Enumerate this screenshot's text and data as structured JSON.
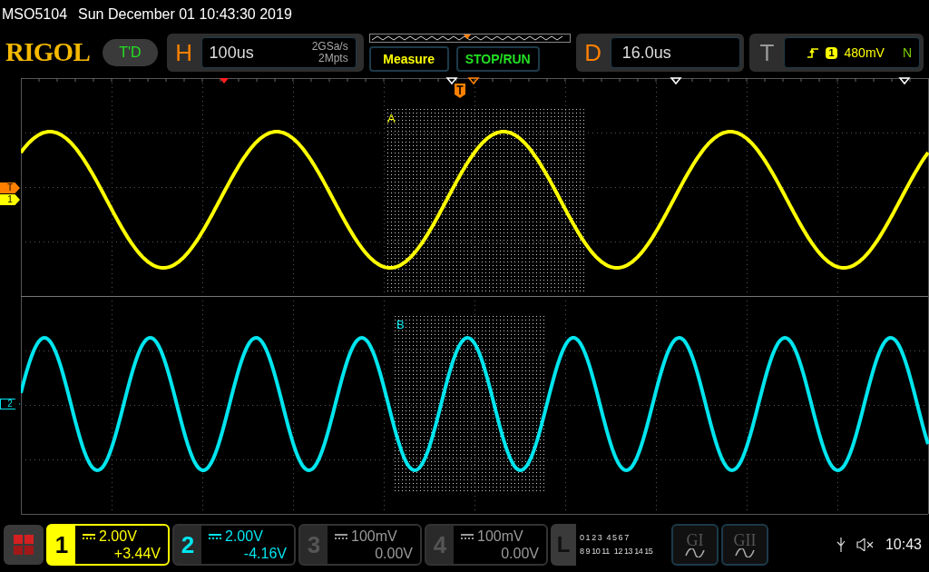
{
  "title_bar": {
    "model": "MSO5104",
    "datetime": "Sun December 01 10:43:30 2019"
  },
  "brand": {
    "logo": "RIGOL",
    "badge": "T'D"
  },
  "horizontal": {
    "label": "H",
    "timebase": "100us",
    "sample_rate": "2GSa/s",
    "memory_depth": "2Mpts"
  },
  "buttons": [
    {
      "label": "Measure",
      "kind": "measure"
    },
    {
      "label": "STOP/RUN",
      "kind": "run"
    }
  ],
  "delay": {
    "label": "D",
    "value": "16.0us"
  },
  "trigger": {
    "label": "T",
    "source": "1",
    "level": "480mV",
    "mode": "N"
  },
  "waveform_area": {
    "zones": [
      {
        "label": "A",
        "color": "#ffff00"
      },
      {
        "label": "B",
        "color": "#00e5ee"
      }
    ],
    "markers": [
      {
        "label": "T",
        "color": "#ff8000"
      },
      {
        "label": "1",
        "color": "#ffff00"
      },
      {
        "label": "2",
        "color": "#00e5ee"
      }
    ]
  },
  "channels": [
    {
      "number": "1",
      "scale": "2.00V",
      "offset": "+3.44V",
      "on": true,
      "selected": true,
      "color": "#ffff00"
    },
    {
      "number": "2",
      "scale": "2.00V",
      "offset": "-4.16V",
      "on": true,
      "selected": false,
      "color": "#00e5ee"
    },
    {
      "number": "3",
      "scale": "100mV",
      "offset": "0.00V",
      "on": false,
      "selected": false
    },
    {
      "number": "4",
      "scale": "100mV",
      "offset": "0.00V",
      "on": false,
      "selected": false
    }
  ],
  "logic": {
    "label": "L",
    "rows": [
      [
        "0 1 2 3",
        "4 5 6 7"
      ],
      [
        "8 9 10 11",
        "12 13 14 15"
      ]
    ]
  },
  "generators": [
    {
      "label": "GI"
    },
    {
      "label": "GII"
    }
  ],
  "status_bar": {
    "time": "10:43"
  }
}
